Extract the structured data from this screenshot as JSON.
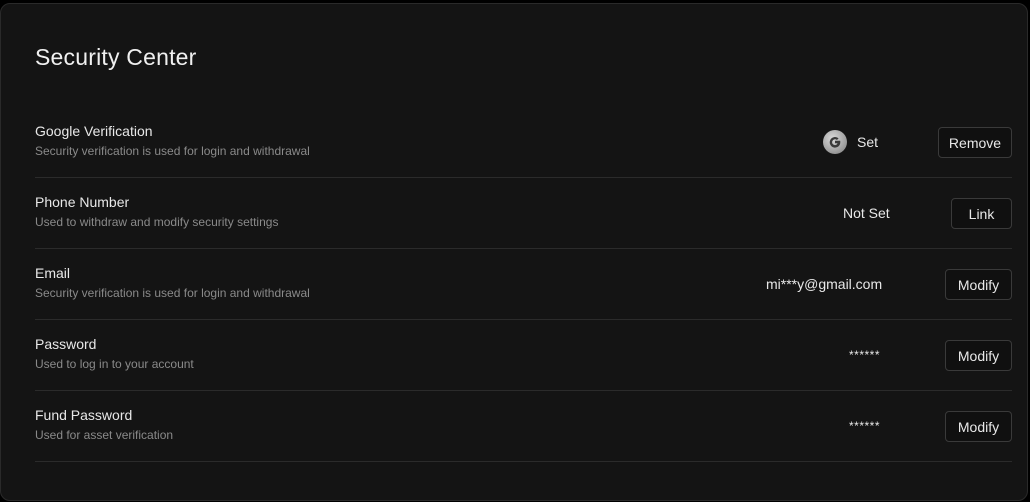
{
  "page": {
    "title": "Security Center"
  },
  "rows": [
    {
      "label": "Google Verification",
      "description": "Security verification is used for login and withdrawal",
      "status_icon": "google-authenticator-icon",
      "value": "Set",
      "action": "Remove"
    },
    {
      "label": "Phone Number",
      "description": "Used to withdraw and modify security settings",
      "value": "Not Set",
      "action": "Link"
    },
    {
      "label": "Email",
      "description": "Security verification is used for login and withdrawal",
      "value": "mi***y@gmail.com",
      "action": "Modify"
    },
    {
      "label": "Password",
      "description": "Used to log in to your account",
      "value": "******",
      "action": "Modify"
    },
    {
      "label": "Fund Password",
      "description": "Used for asset verification",
      "value": "******",
      "action": "Modify"
    }
  ],
  "colors": {
    "page_background": "#000000",
    "panel_background": "#141414",
    "divider": "#2b2b2b",
    "primary_text": "#e8e8e8",
    "secondary_text": "#8a8a8a",
    "button_border": "#3a3a3a"
  }
}
